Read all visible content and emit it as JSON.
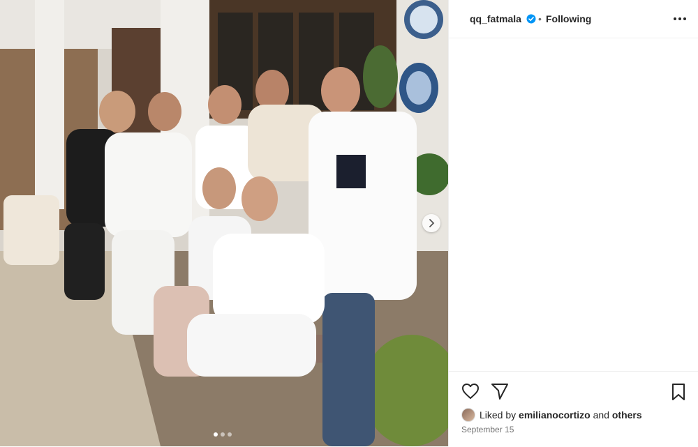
{
  "post": {
    "username": "qq_fatmala",
    "separator": "•",
    "follow_status": "Following",
    "liked_prefix": "Liked by",
    "liked_user": "emilianocortizo",
    "liked_and": "and",
    "liked_suffix": "others",
    "date": "September 15"
  },
  "icons": {
    "verified": "verified-badge-icon",
    "more": "more-options-icon",
    "like": "heart-icon",
    "share": "paper-plane-icon",
    "save": "bookmark-icon",
    "next": "chevron-right-icon"
  },
  "carousel": {
    "count": 3,
    "active": 1
  },
  "colors": {
    "verified": "#0095f6",
    "text": "#262626",
    "muted": "#737373",
    "border": "#efefef"
  }
}
